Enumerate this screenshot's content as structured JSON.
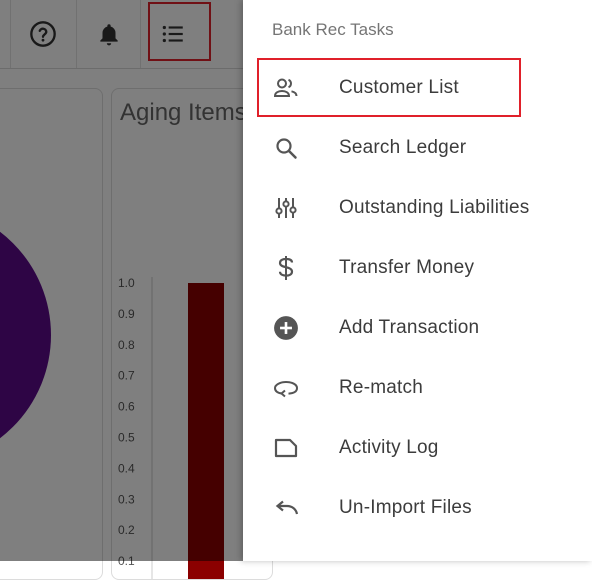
{
  "header": {
    "help_icon": "question-circle-icon",
    "notifications_icon": "bell-icon",
    "menu_icon": "list-menu-icon"
  },
  "dashboard": {
    "aging_card_title": "Aging Items",
    "chart_data": {
      "type": "bar",
      "title": "Aging Items",
      "ylim": [
        0,
        1.0
      ],
      "yticks": [
        "1.0",
        "0.9",
        "0.8",
        "0.7",
        "0.6",
        "0.5",
        "0.4",
        "0.3",
        "0.2",
        "0.1"
      ],
      "values": [
        1.0
      ],
      "colors": [
        "#8b0000"
      ]
    },
    "pie_color": "#5c0a8a"
  },
  "drawer": {
    "title": "Bank Rec Tasks",
    "items": [
      {
        "label": "Customer List",
        "icon": "people-icon"
      },
      {
        "label": "Search Ledger",
        "icon": "search-icon"
      },
      {
        "label": "Outstanding Liabilities",
        "icon": "sliders-icon"
      },
      {
        "label": "Transfer Money",
        "icon": "dollar-icon"
      },
      {
        "label": "Add Transaction",
        "icon": "add-circle-icon"
      },
      {
        "label": "Re-match",
        "icon": "loop-icon"
      },
      {
        "label": "Activity Log",
        "icon": "label-icon"
      },
      {
        "label": "Un-Import Files",
        "icon": "undo-icon"
      }
    ]
  },
  "colors": {
    "highlight": "#e0202a",
    "icon": "#555555",
    "bar": "#8b0000",
    "overlay": "rgba(0,0,0,0.5)"
  }
}
